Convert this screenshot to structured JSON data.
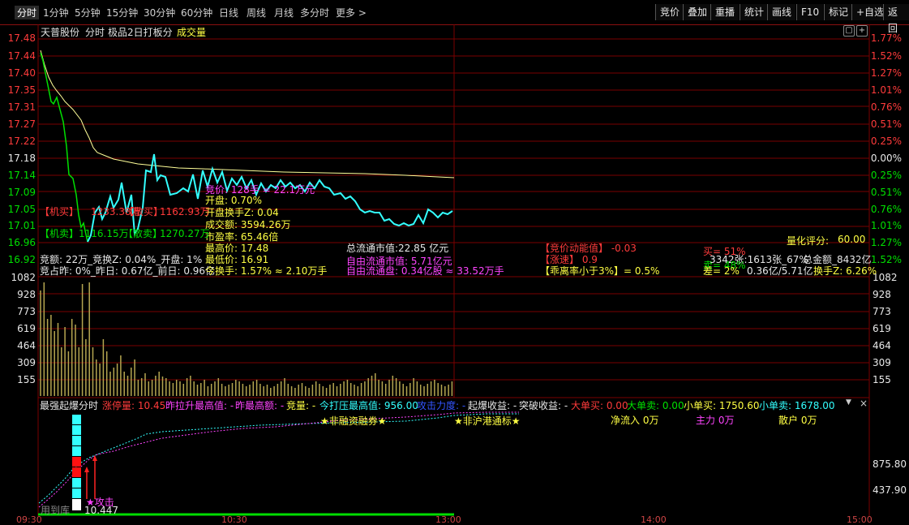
{
  "colors": {
    "up": "#ff3b3b",
    "down": "#00e000",
    "cyan": "#33ffff",
    "yellow": "#ffff44",
    "magenta": "#ff44ff",
    "grid": "#7a0000",
    "avg": "#ffff99",
    "vol": "#b5a650"
  },
  "tabs": [
    "分时",
    "1分钟",
    "5分钟",
    "15分钟",
    "30分钟",
    "60分钟",
    "日线",
    "周线",
    "月线",
    "多分时",
    "更多 >"
  ],
  "right_buttons": [
    "竞价",
    "叠加",
    "重播",
    "统计",
    "画线",
    "F10",
    "标记",
    "+自选",
    "返回"
  ],
  "header": {
    "stock": "天普股份",
    "mode": "分时",
    "formula": "极品2日打板分",
    "volume_label": "成交量"
  },
  "price_axis": [
    "17.48",
    "17.44",
    "17.40",
    "17.35",
    "17.31",
    "17.27",
    "17.22",
    "17.18",
    "17.14",
    "17.09",
    "17.05",
    "17.01",
    "16.96",
    "16.92"
  ],
  "pct_axis": [
    "1.77%",
    "1.52%",
    "1.27%",
    "1.01%",
    "0.76%",
    "0.51%",
    "0.25%",
    "0.00%",
    "0.25%",
    "0.51%",
    "0.76%",
    "1.01%",
    "1.27%",
    "1.52%"
  ],
  "vol_axis": [
    "1082",
    "928",
    "773",
    "619",
    "464",
    "309",
    "155"
  ],
  "bottom_axis": [
    "875.80",
    "437.90"
  ],
  "time_axis": [
    "09:30",
    "10:30",
    "13:00",
    "14:00",
    "15:00"
  ],
  "info": {
    "jingjia": "竞价: 128手 = 22.1万元",
    "kaipan": "开盘: 0.70%",
    "kaipan_hsz": "开盘换手Z: 0.04",
    "chengjiao": "成交额: 3594.26万",
    "shiying": "市盈率: 65.46倍",
    "zuigao": "最高价: 17.48",
    "zuidi": "最低价: 16.91",
    "jimai": "【机买】",
    "jimai_val": "1233.38万",
    "jimai_tag": "【散买】",
    "sanmai_val": "1162.93万",
    "jimai2": "【机卖】",
    "jimai2_val": "1116.15万",
    "sanmai2": "【散卖】",
    "sanmai2_val": "1270.27万",
    "jing_e": "竞额: 22万_竞换Z: 0.04%_开盘: 1%",
    "jing_zhan": "竞占昨: 0%_昨日: 0.67亿_前日: 0.96亿",
    "jin_huan": "今换手: 1.57% ≈ 2.10万手",
    "zong_liutong": "总流通市值:22.85 亿元",
    "ziyou_liutong": "自由流通市值: 5.71亿元",
    "ziyou_liutong_pan": "自由流通盘: 0.34亿股 ≈ 33.52万手",
    "dongneng": "【竞价动能值】 -0.03",
    "zhangsu": "【涨速】 0.9",
    "guali": "【乖离率小于3%】= 0.5%",
    "lianghua": "量化评分:",
    "lianghua_val": "60.00",
    "mai": "买= 51%",
    "ratio": "3342张:1613张_67%",
    "jine": "总金额_8432亿",
    "mai2": "卖= 48%",
    "cha": "差= 2%",
    "liutong2": "0.36亿/5.71亿",
    "huanshouz": "换手Z: 6.26%"
  },
  "bottom_panel": {
    "title": "最强起爆分时",
    "zhangting": "涨停量: 10.45",
    "zuolasheng": "昨拉升最高值: -",
    "zuigaogao": "昨最高额: -",
    "jingliang": "竞量: -",
    "jindaya": "今打压最高值: 956.00",
    "gongjili": "攻击力度: -",
    "qibao": "起爆收益: -",
    "tupo": "突破收益: -",
    "dadanmai": "大单买: 0.00",
    "dadanmai2": "大单卖: 0.00",
    "xiaodanmai": "小单买: 1750.60",
    "xiaodanmai2": "小单卖: 1678.00",
    "rongzi": "★非融资融券★",
    "hugutong": "★非沪港通标★",
    "jingliuru": "净流入 0万",
    "zhuli": "主力 0万",
    "sanhu": "散户 0万",
    "gongji": "★攻击",
    "yongtu": "用到库",
    "val447": "10.447"
  }
}
